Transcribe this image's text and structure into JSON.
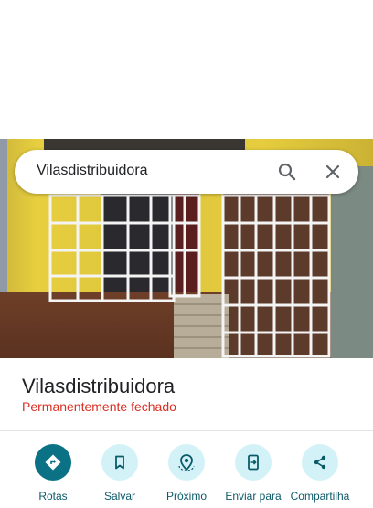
{
  "search": {
    "query": "Vilasdistribuidora",
    "search_icon": "search-icon",
    "close_icon": "close-icon"
  },
  "place": {
    "name": "Vilasdistribuidora",
    "status": "Permanentemente fechado",
    "status_color": "#d93025",
    "photo": "street-view-storefront"
  },
  "actions": [
    {
      "label": "Rotas",
      "icon": "directions-icon"
    },
    {
      "label": "Salvar",
      "icon": "bookmark-icon"
    },
    {
      "label": "Próximo",
      "icon": "nearby-icon"
    },
    {
      "label": "Enviar para",
      "icon": "send-to-phone-icon"
    },
    {
      "label": "Compartilha",
      "icon": "share-icon"
    }
  ],
  "colors": {
    "accent": "#0b7285",
    "action_bg": "#d3f2f8",
    "label": "#0b5a68"
  }
}
